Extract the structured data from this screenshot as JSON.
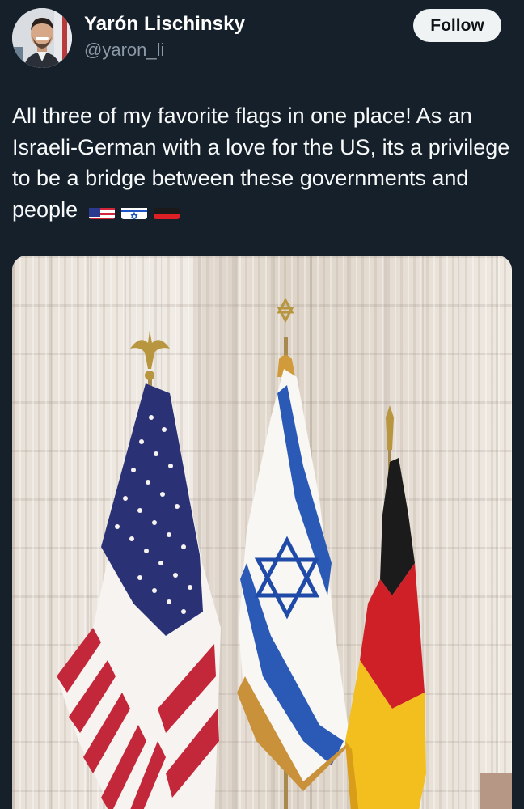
{
  "author": {
    "display_name": "Yarón Lischinsky",
    "handle": "@yaron_li",
    "avatar_icon": "user-avatar-photo"
  },
  "actions": {
    "follow_label": "Follow"
  },
  "tweet": {
    "text": "All three of my favorite flags in one place! As an Israeli-German with a love for the US, its a privilege to be a bridge between these governments and people",
    "emojis": [
      "us-flag-emoji",
      "israel-flag-emoji",
      "germany-flag-emoji"
    ]
  },
  "media": {
    "image_icon": "flags-photo"
  },
  "colors": {
    "background": "#15202b",
    "text": "#f7f9f9",
    "secondary_text": "#8b98a5",
    "follow_button_bg": "#eff3f4"
  }
}
